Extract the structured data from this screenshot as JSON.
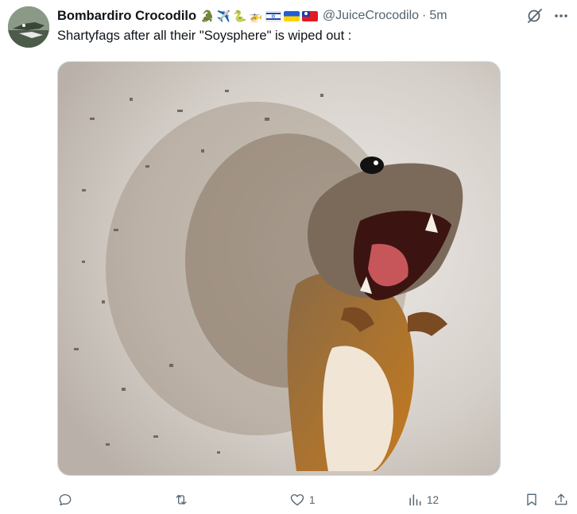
{
  "tweet": {
    "display_name": "Bombardiro Crocodilo",
    "handle": "@JuiceCrocodilo",
    "separator": "·",
    "time": "5m",
    "text": "Shartyfags after all their \"Soysphere\" is wiped out :",
    "name_emojis": [
      "🐊",
      "✈️",
      "🐍",
      "🚁"
    ],
    "name_flags": [
      "israel-flag",
      "ukraine-flag",
      "taiwan-flag"
    ]
  },
  "actions": {
    "reply_count": "",
    "retweet_count": "",
    "like_count": "1",
    "views_count": "12"
  },
  "colors": {
    "text_primary": "#0f1419",
    "text_secondary": "#536471",
    "border": "#cfd9de"
  },
  "icons": {
    "reply": "reply-icon",
    "retweet": "retweet-icon",
    "like": "heart-icon",
    "views": "analytics-icon",
    "bookmark": "bookmark-icon",
    "share": "share-icon",
    "grok": "grok-icon",
    "more": "more-icon"
  }
}
